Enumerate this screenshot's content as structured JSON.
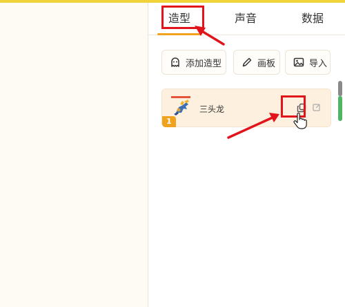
{
  "tabs": [
    {
      "label": "造型",
      "active": true
    },
    {
      "label": "声音",
      "active": false
    },
    {
      "label": "数据",
      "active": false
    }
  ],
  "toolbar": {
    "add_costume": {
      "label": "添加造型",
      "icon": "ghost-icon"
    },
    "paint": {
      "label": "画板",
      "icon": "brush-icon"
    },
    "import": {
      "label": "导入",
      "icon": "image-icon"
    }
  },
  "costumes": [
    {
      "index": "1",
      "name": "三头龙",
      "thumbnail": "dragon-thumbnail"
    }
  ],
  "colors": {
    "accent": "#f0a21f",
    "highlight": "#e0141a",
    "card_bg": "#fdf0df",
    "top_stripe": "#f2d23a",
    "scrollbar": "#4fb463"
  }
}
